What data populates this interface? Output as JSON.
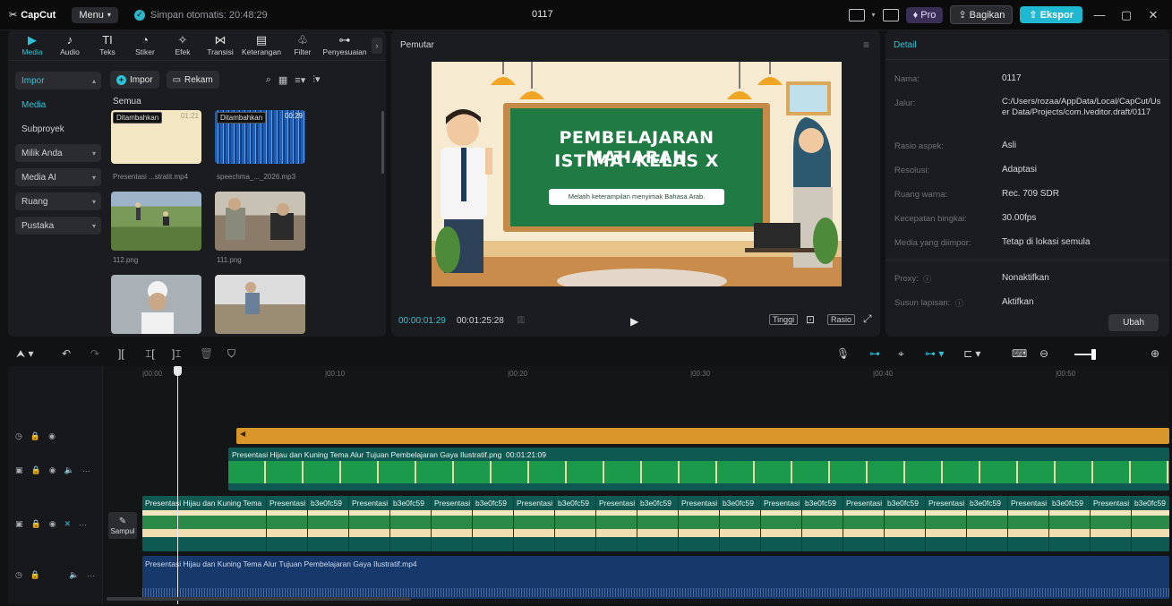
{
  "app": {
    "logo": "CapCut",
    "menu": "Menu",
    "autosave": "Simpan otomatis: 20:48:29",
    "project_title": "0117",
    "pro": "Pro",
    "share": "Bagikan",
    "export": "Ekspor"
  },
  "tools": [
    {
      "label": "Media",
      "icon": "▶"
    },
    {
      "label": "Audio",
      "icon": "♪"
    },
    {
      "label": "Teks",
      "icon": "TI"
    },
    {
      "label": "Stiker",
      "icon": "◔"
    },
    {
      "label": "Efek",
      "icon": "✧"
    },
    {
      "label": "Transisi",
      "icon": "⋈"
    },
    {
      "label": "Keterangan",
      "icon": "▤"
    },
    {
      "label": "Filter",
      "icon": "♧"
    },
    {
      "label": "Penyesuaian",
      "icon": "⊶"
    }
  ],
  "side_nav": [
    {
      "label": "Impor"
    },
    {
      "label": "Media"
    },
    {
      "label": "Subproyek"
    },
    {
      "label": "Milik Anda"
    },
    {
      "label": "Media AI"
    },
    {
      "label": "Ruang"
    },
    {
      "label": "Pustaka"
    }
  ],
  "media_toolbar": {
    "import": "Impor",
    "record": "Rekam"
  },
  "media": {
    "section": "Semua",
    "added": "Ditambahkan",
    "items": [
      {
        "name": "Presentasi ...stratit.mp4",
        "duration": "01:21",
        "added": true
      },
      {
        "name": "speechma_..._2026.mp3",
        "duration": "00:29",
        "added": true
      },
      {
        "name": "112.png"
      },
      {
        "name": "111.png"
      }
    ]
  },
  "player": {
    "title": "Pemutar",
    "slide_title_1": "PEMBELAJARAN MAHARAH",
    "slide_title_2": "ISTIMĀ' KELAS X",
    "slide_subtitle": "Melatih keterampilan menyimak Bahasa Arab.",
    "time_current": "00:00:01:29",
    "time_total": "00:01:25:28",
    "quality": "Tinggi",
    "ratio": "Rasio"
  },
  "detail": {
    "title": "Detail",
    "rows": [
      {
        "label": "Nama:",
        "value": "0117"
      },
      {
        "label": "Jalur:",
        "value": "C:/Users/rozaa/AppData/Local/CapCut/User Data/Projects/com.lveditor.draft/0117"
      },
      {
        "label": "Rasio aspek:",
        "value": "Asli"
      },
      {
        "label": "Resolusi:",
        "value": "Adaptasi"
      },
      {
        "label": "Ruang warna:",
        "value": "Rec. 709 SDR"
      },
      {
        "label": "Kecepatan bingkai:",
        "value": "30.00fps"
      },
      {
        "label": "Media yang diimpor:",
        "value": "Tetap di lokasi semula"
      },
      {
        "label": "Proxy:",
        "value": "Nonaktifkan"
      },
      {
        "label": "Susun lapisan:",
        "value": "Aktifkan"
      }
    ],
    "edit": "Ubah"
  },
  "timeline": {
    "ruler": [
      "|00:00",
      "|00:10",
      "|00:20",
      "|00:30",
      "|00:40",
      "|00:50"
    ],
    "bg_clip_label": "Presentasi Hijau dan Kuning Tema Alur Tujuan Pembelajaran Gaya Ilustratif.png",
    "bg_clip_duration": "00:01:21:09",
    "segment_first": "Presentasi Hijau dan Kuning Tema",
    "segment_a": "Presentasi",
    "segment_b": "b3e0fc59",
    "cover": "Sampul",
    "video_clip_label": "Presentasi Hijau dan Kuning Tema Alur Tujuan Pembelajaran Gaya Ilustratif.mp4"
  }
}
